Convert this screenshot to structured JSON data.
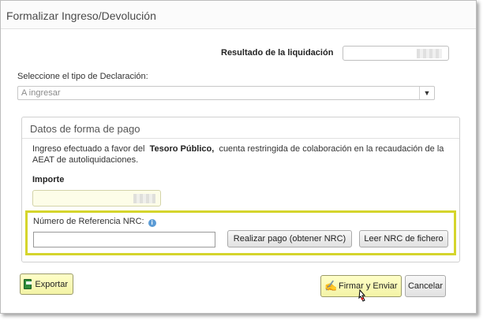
{
  "dialog": {
    "title": "Formalizar Ingreso/Devolución"
  },
  "resultado": {
    "label": "Resultado de la liquidación",
    "value": ""
  },
  "declaracion": {
    "label": "Seleccione el tipo de Declaración:",
    "selected": "A ingresar"
  },
  "pago": {
    "legend": "Datos de forma de pago",
    "info_prefix": "Ingreso efectuado a favor del",
    "info_bold": "Tesoro Público,",
    "info_suffix": "cuenta restringida de colaboración en la recaudación de la AEAT de autoliquidaciones.",
    "importe_label": "Importe",
    "importe_value": ""
  },
  "nrc": {
    "label": "Número de Referencia  NRC:",
    "info_icon_glyph": "i",
    "value": "",
    "btn_pago": "Realizar pago (obtener NRC)",
    "btn_leer": "Leer NRC de fichero"
  },
  "footer": {
    "exportar": "Exportar",
    "firmar": "Firmar y Enviar",
    "cancelar": "Cancelar"
  },
  "icons": {
    "export": "export-icon",
    "sign": "sign-icon",
    "cursor": "hand-cursor-icon",
    "dropdown": "chevron-down-icon",
    "info": "info-icon"
  },
  "colors": {
    "highlight_border": "#d5d52c",
    "yellow_button": "#f7f7b8",
    "info_blue": "#5b9bd5"
  }
}
